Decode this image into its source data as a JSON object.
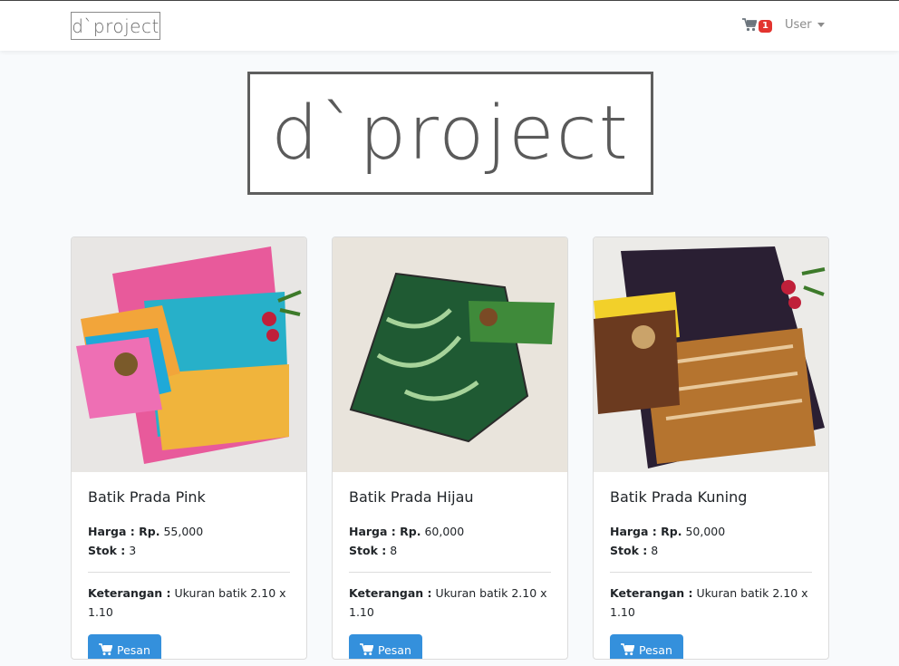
{
  "navbar": {
    "brand": "d`project",
    "cart_count": "1",
    "user_label": "User"
  },
  "hero": {
    "logo_text": "d`project"
  },
  "products": [
    {
      "name": "Batik Prada Pink",
      "price_label": "Harga : Rp.",
      "price": "55,000",
      "stock_label": "Stok :",
      "stock": "3",
      "note_label": "Keterangan :",
      "note": "Ukuran batik 2.10 x 1.10",
      "button": "Pesan"
    },
    {
      "name": "Batik Prada Hijau",
      "price_label": "Harga : Rp.",
      "price": "60,000",
      "stock_label": "Stok :",
      "stock": "8",
      "note_label": "Keterangan :",
      "note": "Ukuran batik 2.10 x 1.10",
      "button": "Pesan"
    },
    {
      "name": "Batik Prada Kuning",
      "price_label": "Harga : Rp.",
      "price": "50,000",
      "stock_label": "Stok :",
      "stock": "8",
      "note_label": "Keterangan :",
      "note": "Ukuran batik 2.10 x 1.10",
      "button": "Pesan"
    }
  ],
  "colors": {
    "primary": "#3490dc",
    "badge": "#e3342f",
    "background": "#f8fafc"
  },
  "icons": {
    "cart": "shopping-cart-icon",
    "dropdown": "chevron-down-icon"
  }
}
